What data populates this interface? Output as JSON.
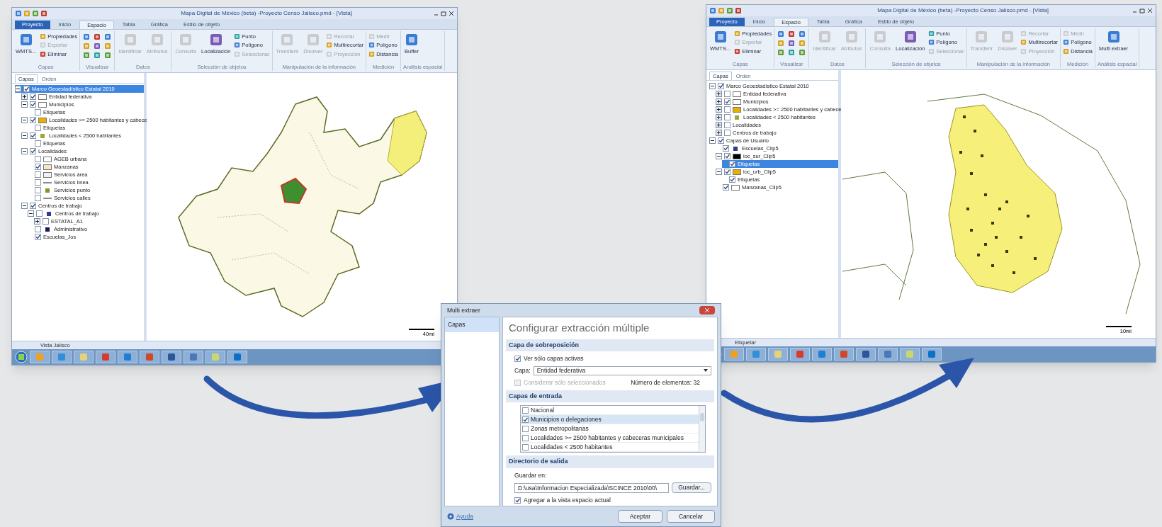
{
  "windows": [
    {
      "title": "Mapa Digital de México (beta) -Proyecto Censo Jalisco.pmd - [Vista]",
      "tabs": [
        {
          "label": "Proyecto",
          "kind": "app",
          "selected": false
        },
        {
          "label": "Inicio",
          "kind": "tab",
          "selected": false
        },
        {
          "label": "Espacio",
          "kind": "tab",
          "selected": true
        },
        {
          "label": "Tabla",
          "kind": "tab",
          "selected": false
        },
        {
          "label": "Gráfica",
          "kind": "tab",
          "selected": false
        },
        {
          "label": "Estilo de objeto",
          "kind": "tab",
          "selected": false
        }
      ],
      "ribbon": [
        {
          "label": "Capas",
          "items": [
            {
              "label": "WMTS...",
              "kind": "large",
              "disabled": false
            },
            {
              "label": "Propiedades",
              "kind": "small",
              "disabled": false
            },
            {
              "label": "Exportar",
              "kind": "small",
              "disabled": true
            },
            {
              "label": "Eliminar",
              "kind": "small",
              "disabled": false
            }
          ]
        },
        {
          "label": "Visualizar",
          "items": [
            {
              "kind": "icon",
              "disabled": false
            },
            {
              "kind": "icon",
              "disabled": false
            },
            {
              "kind": "icon",
              "disabled": false
            },
            {
              "kind": "icon",
              "disabled": false
            },
            {
              "kind": "icon",
              "disabled": false
            },
            {
              "kind": "icon",
              "disabled": false
            },
            {
              "kind": "icon",
              "disabled": false
            },
            {
              "kind": "icon",
              "disabled": false
            },
            {
              "kind": "icon",
              "disabled": false
            }
          ]
        },
        {
          "label": "Datos",
          "items": [
            {
              "label": "Identificar",
              "kind": "large",
              "disabled": true
            },
            {
              "label": "Atributos",
              "kind": "large",
              "disabled": true
            }
          ]
        },
        {
          "label": "Selección de objetos",
          "items": [
            {
              "label": "Consulta",
              "kind": "large",
              "disabled": true
            },
            {
              "label": "Localización",
              "kind": "large",
              "disabled": false
            },
            {
              "label": "Punto",
              "kind": "small",
              "disabled": false
            },
            {
              "label": "Polígono",
              "kind": "small",
              "disabled": false
            },
            {
              "label": "Seleccionar",
              "kind": "small",
              "disabled": true
            }
          ]
        },
        {
          "label": "Manipulación de la información",
          "items": [
            {
              "label": "Transferir",
              "kind": "large",
              "disabled": true
            },
            {
              "label": "Disolver",
              "kind": "large",
              "disabled": true
            },
            {
              "label": "Recortar",
              "kind": "small",
              "disabled": true
            },
            {
              "label": "Multirecortar",
              "kind": "small",
              "disabled": false
            },
            {
              "label": "Proyección",
              "kind": "small",
              "disabled": true
            }
          ]
        },
        {
          "label": "Medición",
          "items": [
            {
              "label": "Medir",
              "kind": "small",
              "disabled": true
            },
            {
              "label": "Polígono",
              "kind": "small",
              "disabled": false
            },
            {
              "label": "Distancia",
              "kind": "small",
              "disabled": false
            }
          ]
        },
        {
          "label": "Análisis espacial",
          "items": [
            {
              "label": "Buffer",
              "kind": "large",
              "disabled": false
            }
          ]
        }
      ],
      "panel_tabs": [
        {
          "label": "Capas",
          "selected": true
        },
        {
          "label": "Orden",
          "selected": false
        }
      ],
      "layers": [
        {
          "label": "Marco Geoestadístico Estatal 2010",
          "checked": true,
          "selected": true,
          "expanded": true,
          "children": [
            {
              "label": "Entidad federativa",
              "checked": true,
              "selected": false,
              "expanded": false,
              "kind": "fill",
              "color": "#ffffff"
            },
            {
              "label": "Municipios",
              "checked": true,
              "selected": false,
              "expanded": true,
              "kind": "fill",
              "color": "#ffffff",
              "children": [
                {
                  "label": "Etiquetas",
                  "checked": false,
                  "selected": false
                }
              ]
            },
            {
              "label": "Localidades >= 2500 habitantes y cabece",
              "checked": true,
              "selected": false,
              "expanded": true,
              "kind": "fill",
              "color": "#e8b000",
              "children": [
                {
                  "label": "Etiquetas",
                  "checked": false,
                  "selected": false
                }
              ]
            },
            {
              "label": "Localidades < 2500 habitantes",
              "checked": true,
              "selected": false,
              "expanded": true,
              "kind": "point",
              "color": "#9aa83a",
              "children": [
                {
                  "label": "Etiquetas",
                  "checked": false,
                  "selected": false
                }
              ]
            },
            {
              "label": "Localidades",
              "checked": true,
              "selected": false,
              "expanded": true,
              "children": [
                {
                  "label": "AGEB urbana",
                  "checked": false,
                  "selected": false,
                  "kind": "fill",
                  "color": "#ffffff"
                },
                {
                  "label": "Manzanas",
                  "checked": true,
                  "selected": false,
                  "kind": "fill",
                  "color": "#fbe3c8"
                },
                {
                  "label": "Servicios área",
                  "checked": false,
                  "selected": false,
                  "kind": "fill",
                  "color": "#eef2f7"
                },
                {
                  "label": "Servicios línea",
                  "checked": false,
                  "selected": false,
                  "kind": "line",
                  "color": "#8a8a8a"
                },
                {
                  "label": "Servicios punto",
                  "checked": false,
                  "selected": false,
                  "kind": "point",
                  "color": "#7a9a30"
                },
                {
                  "label": "Servicios calles",
                  "checked": false,
                  "selected": false,
                  "kind": "line",
                  "color": "#8a8a8a"
                }
              ]
            },
            {
              "label": "Centros de trabajo",
              "checked": true,
              "selected": false,
              "expanded": true,
              "children": [
                {
                  "label": "Centros de trabajo",
                  "checked": false,
                  "selected": false,
                  "expanded": true,
                  "kind": "point",
                  "color": "#2b3f8f",
                  "children": [
                    {
                      "label": "ESTATAL_A1",
                      "checked": false,
                      "selected": false,
                      "expanded": false
                    }
                  ]
                },
                {
                  "label": "Administrativo",
                  "checked": false,
                  "selected": false,
                  "kind": "point",
                  "color": "#1a1a5a"
                },
                {
                  "label": "Escuelas_Jos",
                  "checked": true,
                  "selected": false
                }
              ]
            }
          ]
        }
      ],
      "map": {
        "kind": "state"
      },
      "scale_label": "40mi",
      "status_text": "Vista Jalisco"
    },
    {
      "title": "Mapa Digital de México (beta) -Proyecto Censo Jalisco.pmd - [Vista]",
      "tabs": [
        {
          "label": "Proyecto",
          "kind": "app",
          "selected": false
        },
        {
          "label": "Inicio",
          "kind": "tab",
          "selected": false
        },
        {
          "label": "Espacio",
          "kind": "tab",
          "selected": true
        },
        {
          "label": "Tabla",
          "kind": "tab",
          "selected": false
        },
        {
          "label": "Gráfica",
          "kind": "tab",
          "selected": false
        },
        {
          "label": "Estilo de objeto",
          "kind": "tab",
          "selected": false
        }
      ],
      "ribbon": [
        {
          "label": "Capas",
          "items": [
            {
              "label": "WMTS...",
              "kind": "large",
              "disabled": false
            },
            {
              "label": "Propiedades",
              "kind": "small",
              "disabled": false
            },
            {
              "label": "Exportar",
              "kind": "small",
              "disabled": true
            },
            {
              "label": "Eliminar",
              "kind": "small",
              "disabled": false
            }
          ]
        },
        {
          "label": "Visualizar",
          "items": [
            {
              "kind": "icon",
              "disabled": false
            },
            {
              "kind": "icon",
              "disabled": false
            },
            {
              "kind": "icon",
              "disabled": false
            },
            {
              "kind": "icon",
              "disabled": false
            },
            {
              "kind": "icon",
              "disabled": false
            },
            {
              "kind": "icon",
              "disabled": false
            },
            {
              "kind": "icon",
              "disabled": false
            },
            {
              "kind": "icon",
              "disabled": false
            },
            {
              "kind": "icon",
              "disabled": false
            }
          ]
        },
        {
          "label": "Datos",
          "items": [
            {
              "label": "Identificar",
              "kind": "large",
              "disabled": true
            },
            {
              "label": "Atributos",
              "kind": "large",
              "disabled": true
            }
          ]
        },
        {
          "label": "Selección de objetos",
          "items": [
            {
              "label": "Consulta",
              "kind": "large",
              "disabled": true
            },
            {
              "label": "Localización",
              "kind": "large",
              "disabled": false
            },
            {
              "label": "Punto",
              "kind": "small",
              "disabled": false
            },
            {
              "label": "Polígono",
              "kind": "small",
              "disabled": false
            },
            {
              "label": "Seleccionar",
              "kind": "small",
              "disabled": true
            }
          ]
        },
        {
          "label": "Manipulación de la información",
          "items": [
            {
              "label": "Transferir",
              "kind": "large",
              "disabled": true
            },
            {
              "label": "Disolver",
              "kind": "large",
              "disabled": true
            },
            {
              "label": "Recortar",
              "kind": "small",
              "disabled": true
            },
            {
              "label": "Multirecortar",
              "kind": "small",
              "disabled": false
            },
            {
              "label": "Proyección",
              "kind": "small",
              "disabled": true
            }
          ]
        },
        {
          "label": "Medición",
          "items": [
            {
              "label": "Medir",
              "kind": "small",
              "disabled": true
            },
            {
              "label": "Polígono",
              "kind": "small",
              "disabled": false
            },
            {
              "label": "Distancia",
              "kind": "small",
              "disabled": false
            }
          ]
        },
        {
          "label": "Análisis espacial",
          "items": [
            {
              "label": "Multi extraer",
              "kind": "large",
              "disabled": false
            }
          ]
        }
      ],
      "panel_tabs": [
        {
          "label": "Capas",
          "selected": true
        },
        {
          "label": "Orden",
          "selected": false
        }
      ],
      "layers": [
        {
          "label": "Marco Geoestadístico Estatal 2010",
          "checked": true,
          "selected": false,
          "expanded": true,
          "children": [
            {
              "label": "Entidad federativa",
              "checked": false,
              "selected": false,
              "expanded": false,
              "kind": "fill",
              "color": "#ffffff"
            },
            {
              "label": "Municipios",
              "checked": true,
              "selected": false,
              "expanded": false,
              "kind": "fill",
              "color": "#ffffff"
            },
            {
              "label": "Localidades >= 2500 habitantes y cabece",
              "checked": false,
              "selected": false,
              "expanded": false,
              "kind": "fill",
              "color": "#e8b000"
            },
            {
              "label": "Localidades < 2500 habitantes",
              "checked": false,
              "selected": false,
              "expanded": false,
              "kind": "point",
              "color": "#9aa83a"
            },
            {
              "label": "Localidades",
              "checked": false,
              "selected": false,
              "expanded": false
            },
            {
              "label": "Centros de trabajo",
              "checked": false,
              "selected": false,
              "expanded": false
            }
          ]
        },
        {
          "label": "Capas de Usuario",
          "checked": true,
          "selected": false,
          "expanded": true,
          "children": [
            {
              "label": "Escuelas_Clip5",
              "checked": true,
              "selected": false,
              "kind": "point",
              "color": "#2b3f8f"
            },
            {
              "label": "loc_sur_Clip5",
              "checked": true,
              "selected": false,
              "expanded": true,
              "kind": "fill",
              "color": "#000000",
              "children": [
                {
                  "label": "Etiquetas",
                  "checked": true,
                  "selected": true
                }
              ]
            },
            {
              "label": "loc_urb_Clip5",
              "checked": true,
              "selected": false,
              "expanded": true,
              "kind": "fill",
              "color": "#e8b000",
              "children": [
                {
                  "label": "Etiquetas",
                  "checked": true,
                  "selected": false
                }
              ]
            },
            {
              "label": "Manzanas_Clip5",
              "checked": true,
              "selected": false,
              "kind": "fill",
              "color": "#ffffff"
            }
          ]
        }
      ],
      "map": {
        "kind": "clip"
      },
      "scale_label": "10mi",
      "status_text": "Etiquetar"
    }
  ],
  "dialog": {
    "title": "Multi extraer",
    "nav": [
      {
        "label": "Capas",
        "selected": true
      }
    ],
    "heading": "Configurar extracción múltiple",
    "overlay": {
      "header": "Capa de sobreposición",
      "only_active": {
        "label": "Ver sólo capas activas",
        "checked": true
      },
      "layer_label": "Capa:",
      "layer_value": "Entidad federativa",
      "only_selected": {
        "label": "Considerar sólo seleccionados",
        "checked": false,
        "disabled": true
      },
      "count": "Número de elementos: 32"
    },
    "inputs": {
      "header": "Capas de entrada",
      "items": [
        {
          "label": "Nacional",
          "checked": false,
          "selected": false
        },
        {
          "label": "Municipios o delegaciones",
          "checked": true,
          "selected": true
        },
        {
          "label": "Zonas metropolitanas",
          "checked": false,
          "selected": false
        },
        {
          "label": "Localidades >= 2500 habitantes y cabeceras municipales",
          "checked": false,
          "selected": false
        },
        {
          "label": "Localidades < 2500 habitantes",
          "checked": false,
          "selected": false
        }
      ]
    },
    "output": {
      "header": "Directorio de salida",
      "save_label": "Guardar en:",
      "path": "D:\\usa\\Informacion Especializada\\SCINCE 2010\\00\\",
      "browse": "Guardar...",
      "add_view": {
        "label": "Agregar a la vista espacio actual",
        "checked": true
      }
    },
    "help": "Ayuda",
    "ok": "Aceptar",
    "cancel": "Cancelar"
  }
}
